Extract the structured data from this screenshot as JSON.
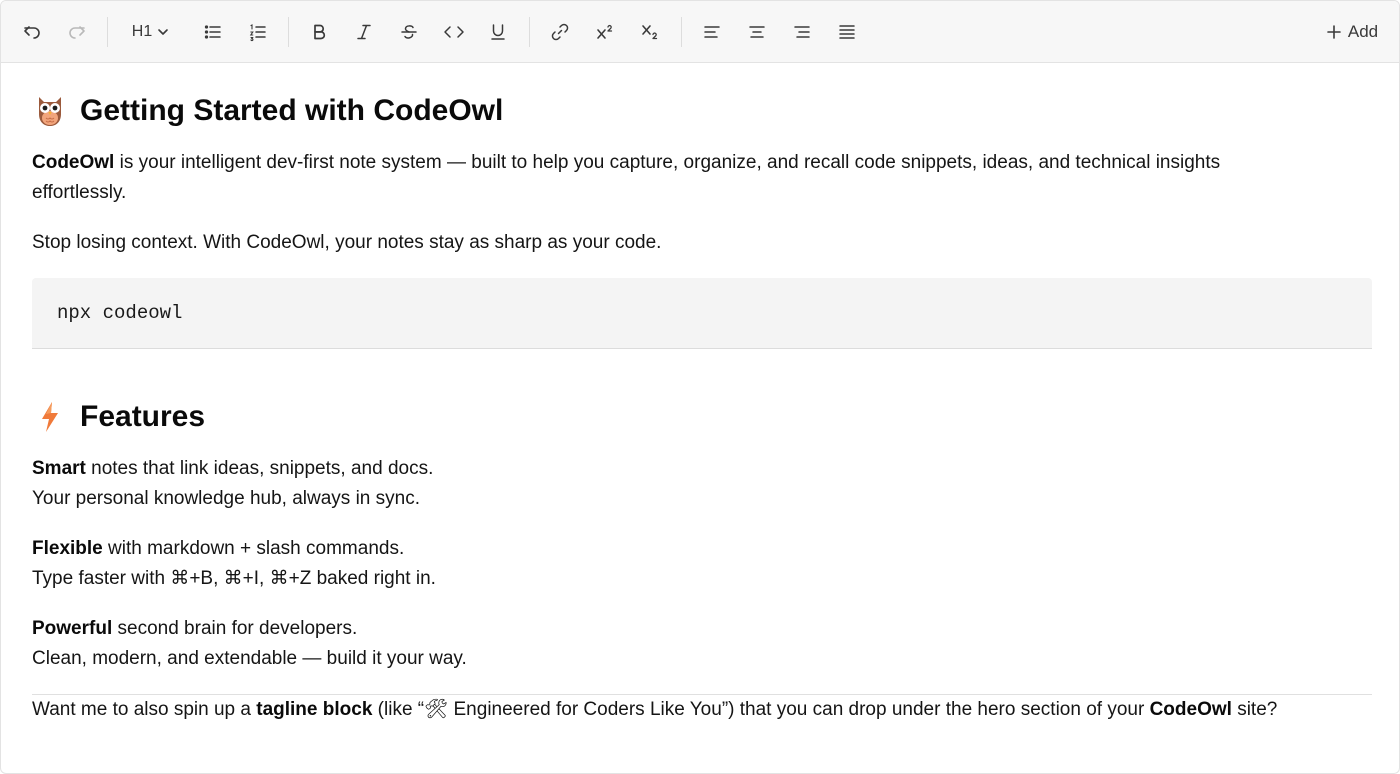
{
  "toolbar": {
    "heading_label": "H1",
    "add_label": "Add"
  },
  "doc": {
    "heading1": "Getting Started with CodeOwl",
    "intro_bold": "CodeOwl",
    "intro_rest_line1": " is your intelligent dev-first note system — built to help you capture, organize, and recall code snippets, ideas, and technical insights",
    "intro_rest_line2": "effortlessly.",
    "tagline": "Stop losing context. With CodeOwl, your notes stay as sharp as your code.",
    "code": "npx codeowl",
    "heading2": "Features",
    "features": [
      {
        "bold": "Smart",
        "rest": " notes that link ideas, snippets, and docs.",
        "line2": "Your personal knowledge hub, always in sync."
      },
      {
        "bold": "Flexible",
        "rest": " with markdown + slash commands.",
        "line2": "Type faster with ⌘+B, ⌘+I, ⌘+Z baked right in."
      },
      {
        "bold": "Powerful",
        "rest": " second brain for developers.",
        "line2": "Clean, modern, and extendable — build it your way."
      }
    ],
    "closing": {
      "part1": "Want me to also spin up a ",
      "bold1": "tagline block",
      "part2": " (like “🛠 Engineered for Coders Like You”) that you can drop under the hero section of your ",
      "bold2": "CodeOwl",
      "part3": " site?"
    }
  },
  "colors": {
    "toolbar_bg": "#f7f7f7",
    "code_bg": "#f4f4f4",
    "text": "#151515",
    "owl": "#e8845a",
    "bolt": "#f07a3a"
  }
}
